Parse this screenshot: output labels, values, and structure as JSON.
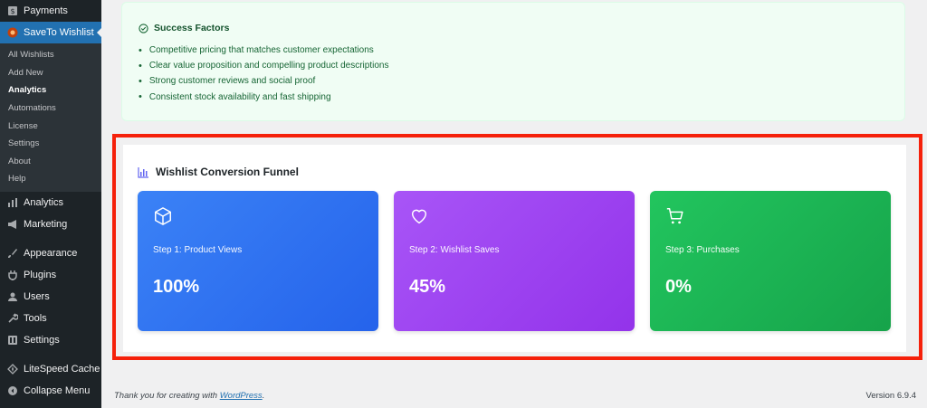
{
  "sidebar": {
    "top_items": [
      {
        "label": "Payments",
        "icon": "payments-icon"
      },
      {
        "label": "SaveTo Wishlist",
        "icon": "wishlist-plugin-icon"
      }
    ],
    "submenu": [
      {
        "label": "All Wishlists"
      },
      {
        "label": "Add New"
      },
      {
        "label": "Analytics"
      },
      {
        "label": "Automations"
      },
      {
        "label": "License"
      },
      {
        "label": "Settings"
      },
      {
        "label": "About"
      },
      {
        "label": "Help"
      }
    ],
    "bottom_items": [
      {
        "label": "Analytics",
        "icon": "analytics-icon"
      },
      {
        "label": "Marketing",
        "icon": "megaphone-icon"
      },
      {
        "label": "Appearance",
        "icon": "paintbrush-icon"
      },
      {
        "label": "Plugins",
        "icon": "plugin-icon"
      },
      {
        "label": "Users",
        "icon": "users-icon"
      },
      {
        "label": "Tools",
        "icon": "wrench-icon"
      },
      {
        "label": "Settings",
        "icon": "settings-icon"
      },
      {
        "label": "LiteSpeed Cache",
        "icon": "litespeed-icon"
      },
      {
        "label": "Collapse Menu",
        "icon": "collapse-icon"
      }
    ]
  },
  "success": {
    "title": "Success Factors",
    "items": [
      "Competitive pricing that matches customer expectations",
      "Clear value proposition and compelling product descriptions",
      "Strong customer reviews and social proof",
      "Consistent stock availability and fast shipping"
    ]
  },
  "funnel": {
    "title": "Wishlist Conversion Funnel",
    "steps": [
      {
        "label": "Step 1: Product Views",
        "value": "100%",
        "icon": "box-icon",
        "color": "#3b82f6"
      },
      {
        "label": "Step 2: Wishlist Saves",
        "value": "45%",
        "icon": "heart-icon",
        "color": "#a855f7"
      },
      {
        "label": "Step 3: Purchases",
        "value": "0%",
        "icon": "cart-icon",
        "color": "#22c55e"
      }
    ]
  },
  "footer": {
    "thanks_prefix": "Thank you for creating with ",
    "thanks_link": "WordPress",
    "thanks_suffix": ".",
    "version": "Version 6.9.4"
  }
}
